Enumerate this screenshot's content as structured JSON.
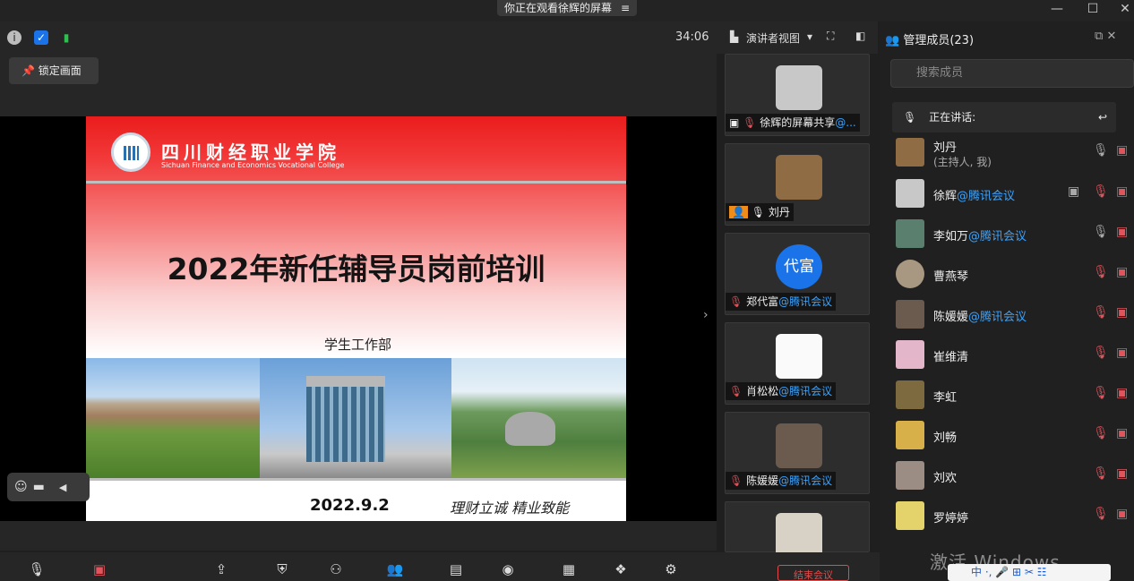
{
  "top": {
    "share_banner": "你正在观看徐辉的屏幕",
    "banner_menu_icon": "list-icon"
  },
  "window": {
    "min_icon": "minimize-icon",
    "max_icon": "maximize-icon",
    "close_icon": "close-icon"
  },
  "infobar": {
    "timer": "34:06",
    "lock_label": "锁定画面"
  },
  "view": {
    "presenter_view": "演讲者视图"
  },
  "slide": {
    "college_cn": "四川财经职业学院",
    "college_en": "Sichuan Finance and Economics Vocational College",
    "title": "2022年新任辅导员岗前培训",
    "dept": "学生工作部",
    "date": "2022.9.2",
    "motto": "理财立诚 精业致能"
  },
  "gallery": [
    {
      "name": "徐辉的屏幕共享",
      "suffix": "@...",
      "avatar": "#c8c8c8"
    },
    {
      "name": "刘丹",
      "suffix": "",
      "avatar": "#8f6c44"
    },
    {
      "name": "郑代富",
      "suffix": "@腾讯会议",
      "avatar": "#1a73e8",
      "initials": "代富"
    },
    {
      "name": "肖松松",
      "suffix": "@腾讯会议",
      "avatar": "#fafafa"
    },
    {
      "name": "陈媛媛",
      "suffix": "@腾讯会议",
      "avatar": "#6b5a4e"
    }
  ],
  "panel": {
    "title": "管理成员(23)",
    "search_placeholder": "搜索成员",
    "speaking_label": "正在讲话:",
    "members": [
      {
        "name": "刘丹",
        "sub": "(主持人, 我)",
        "suffix": "",
        "avatar": "#8f6c44"
      },
      {
        "name": "徐辉",
        "suffix": "@腾讯会议",
        "avatar": "#c8c8c8"
      },
      {
        "name": "李如万",
        "suffix": "@腾讯会议",
        "avatar": "#5a7f6e"
      },
      {
        "name": "曹燕琴",
        "suffix": "",
        "avatar": "#a89882"
      },
      {
        "name": "陈媛媛",
        "suffix": "@腾讯会议",
        "avatar": "#6b5a4e"
      },
      {
        "name": "崔维清",
        "suffix": "",
        "avatar": "#e3b7c9"
      },
      {
        "name": "李虹",
        "suffix": "",
        "avatar": "#7d6a3e"
      },
      {
        "name": "刘畅",
        "suffix": "",
        "avatar": "#d8b04a"
      },
      {
        "name": "刘欢",
        "suffix": "",
        "avatar": "#9b8c84"
      },
      {
        "name": "罗婷婷",
        "suffix": "",
        "avatar": "#e4d36b"
      }
    ]
  },
  "toolbar": {
    "end_label": "结束会议"
  },
  "watermark": "激活 Windows",
  "ime": "中 ·, 🎤 ⊞ ✂ ☷"
}
